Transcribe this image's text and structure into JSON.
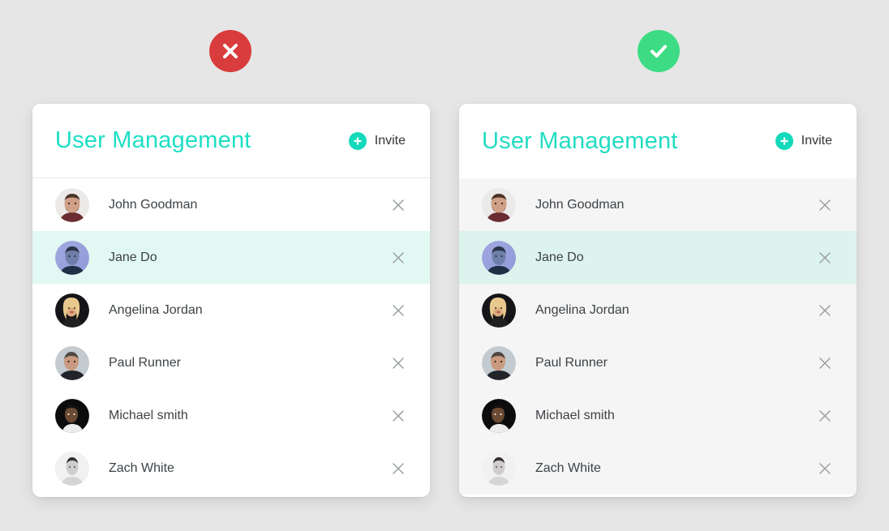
{
  "page": {
    "background_color": "#e6e6e6"
  },
  "badges": [
    {
      "name": "incorrect",
      "symbol": "cross",
      "color": "#d93c3c"
    },
    {
      "name": "correct",
      "symbol": "check",
      "color": "#3ddc84"
    }
  ],
  "cards": [
    {
      "variant": "incorrect-example",
      "title": "User Management",
      "title_color": "#1ddfc4",
      "invite": {
        "label": "Invite",
        "icon": "plus-icon",
        "icon_color": "#14d9bb"
      },
      "list_background": "#ffffff",
      "selected_row_color": "#e2f8f3",
      "users": [
        {
          "name": "John Goodman",
          "avatar": "john-goodman-avatar",
          "selected": false,
          "remove_icon": "close-icon"
        },
        {
          "name": "Jane Do",
          "avatar": "jane-do-avatar",
          "selected": true,
          "remove_icon": "close-icon"
        },
        {
          "name": "Angelina Jordan",
          "avatar": "angelina-jordan-avatar",
          "selected": false,
          "remove_icon": "close-icon"
        },
        {
          "name": "Paul Runner",
          "avatar": "paul-runner-avatar",
          "selected": false,
          "remove_icon": "close-icon"
        },
        {
          "name": "Michael smith",
          "avatar": "michael-smith-avatar",
          "selected": false,
          "remove_icon": "close-icon"
        },
        {
          "name": "Zach White",
          "avatar": "zach-white-avatar",
          "selected": false,
          "remove_icon": "close-icon"
        }
      ]
    },
    {
      "variant": "correct-example",
      "title": "User Management",
      "title_color": "#21dcc2",
      "invite": {
        "label": "Invite",
        "icon": "plus-icon",
        "icon_color": "#14d9bb"
      },
      "list_background": "#f5f5f5",
      "selected_row_color": "#dcf3ee",
      "users": [
        {
          "name": "John Goodman",
          "avatar": "john-goodman-avatar",
          "selected": false,
          "remove_icon": "close-icon"
        },
        {
          "name": "Jane Do",
          "avatar": "jane-do-avatar",
          "selected": true,
          "remove_icon": "close-icon"
        },
        {
          "name": "Angelina Jordan",
          "avatar": "angelina-jordan-avatar",
          "selected": false,
          "remove_icon": "close-icon"
        },
        {
          "name": "Paul Runner",
          "avatar": "paul-runner-avatar",
          "selected": false,
          "remove_icon": "close-icon"
        },
        {
          "name": "Michael smith",
          "avatar": "michael-smith-avatar",
          "selected": false,
          "remove_icon": "close-icon"
        },
        {
          "name": "Zach White",
          "avatar": "zach-white-avatar",
          "selected": false,
          "remove_icon": "close-icon"
        }
      ]
    }
  ]
}
